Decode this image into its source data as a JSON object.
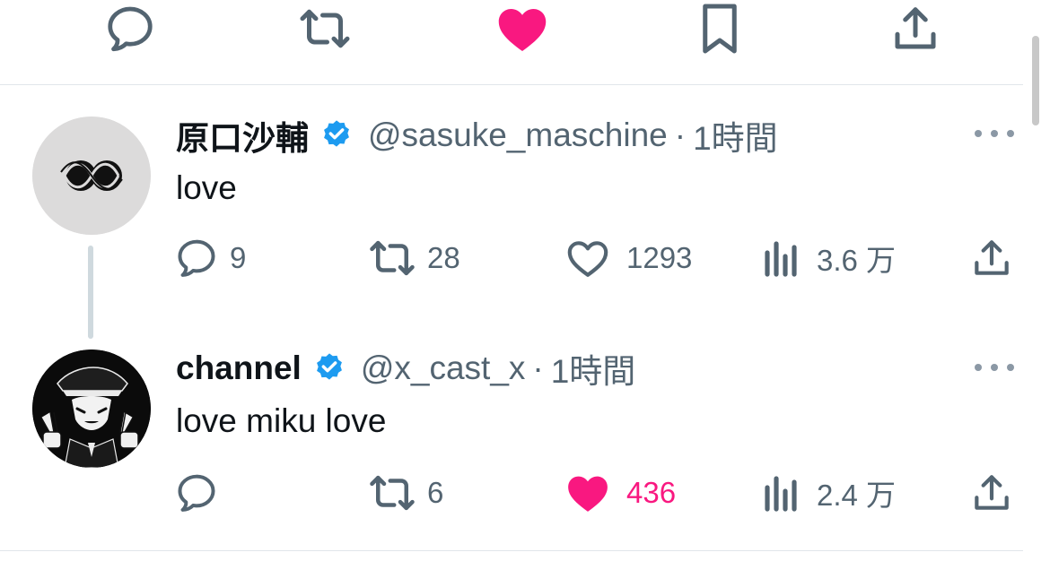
{
  "colors": {
    "accent_pink": "#f91880",
    "icon_gray": "#536471",
    "verified_blue": "#1d9bf0",
    "text": "#0f1419"
  },
  "top_actions": {
    "icons": [
      "reply-icon",
      "retweet-icon",
      "like-filled-icon",
      "bookmark-icon",
      "share-icon"
    ],
    "liked": true
  },
  "tweets": [
    {
      "name": "原口沙輔",
      "verified": true,
      "handle": "@sasuke_maschine",
      "separator": "·",
      "time": "1時間",
      "text": "love",
      "replies": "9",
      "retweets": "28",
      "likes": "1293",
      "liked": false,
      "views": "3.6 万"
    },
    {
      "name": "channel",
      "verified": true,
      "handle": "@x_cast_x",
      "separator": "·",
      "time": "1時間",
      "text": "love miku love",
      "replies": "",
      "retweets": "6",
      "likes": "436",
      "liked": true,
      "views": "2.4 万"
    }
  ]
}
